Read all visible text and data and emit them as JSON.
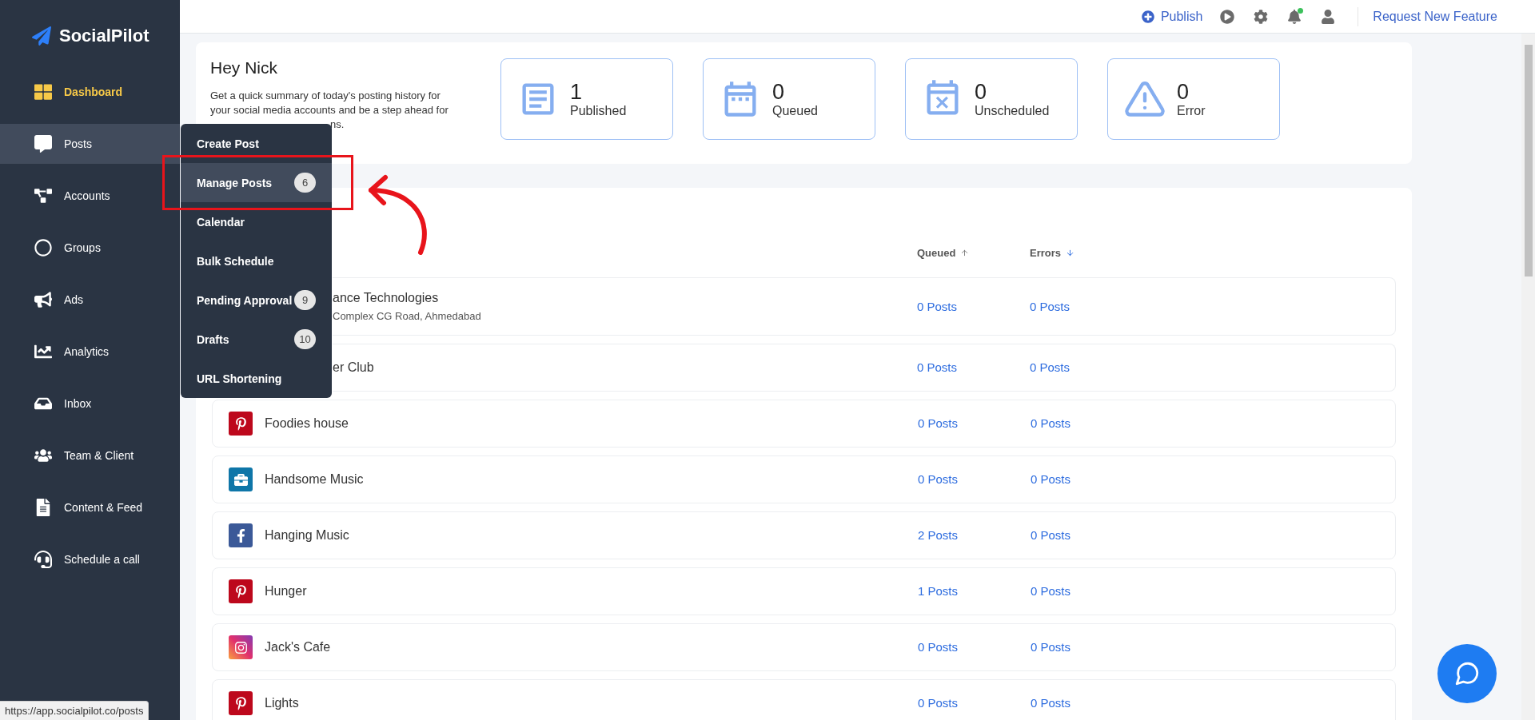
{
  "brand": "SocialPilot",
  "sidebar": {
    "items": [
      {
        "label": "Dashboard",
        "selected": true,
        "hovered": false
      },
      {
        "label": "Posts",
        "selected": false,
        "hovered": true
      },
      {
        "label": "Accounts",
        "selected": false,
        "hovered": false
      },
      {
        "label": "Groups",
        "selected": false,
        "hovered": false
      },
      {
        "label": "Ads",
        "selected": false,
        "hovered": false
      },
      {
        "label": "Analytics",
        "selected": false,
        "hovered": false
      },
      {
        "label": "Inbox",
        "selected": false,
        "hovered": false
      },
      {
        "label": "Team & Client",
        "selected": false,
        "hovered": false
      },
      {
        "label": "Content & Feed",
        "selected": false,
        "hovered": false
      },
      {
        "label": "Schedule a call",
        "selected": false,
        "hovered": false
      }
    ]
  },
  "topbar": {
    "publish": "Publish",
    "request": "Request New Feature",
    "notification_dot": true
  },
  "summary": {
    "greeting": "Hey Nick",
    "lines": [
      {
        "text": "Get a quick summary of today's posting history for",
        "covered": false
      },
      {
        "text": "your social media accounts and be a step ahead for",
        "covered": false
      },
      {
        "text": "ns.",
        "covered": true
      }
    ],
    "stats": [
      {
        "value": "1",
        "label": "Published"
      },
      {
        "value": "0",
        "label": "Queued"
      },
      {
        "value": "0",
        "label": "Unscheduled"
      },
      {
        "value": "0",
        "label": "Error"
      }
    ]
  },
  "table": {
    "columns": [
      {
        "label": "Queued",
        "ascending": true,
        "active": false
      },
      {
        "label": "Errors",
        "ascending": false,
        "active": true
      }
    ],
    "rows": [
      {
        "kind": "covered",
        "name": "ance Technologies",
        "subtitle": "Complex CG Road, Ahmedabad",
        "queued": "0 Posts",
        "errors": "0 Posts"
      },
      {
        "kind": "covered",
        "name": "er Club",
        "queued": "0 Posts",
        "errors": "0 Posts"
      },
      {
        "kind": "pinterest",
        "name": "Foodies house",
        "queued": "0 Posts",
        "errors": "0 Posts"
      },
      {
        "kind": "business",
        "name": "Handsome Music",
        "queued": "0 Posts",
        "errors": "0 Posts"
      },
      {
        "kind": "facebook",
        "name": "Hanging Music",
        "queued": "2 Posts",
        "errors": "0 Posts"
      },
      {
        "kind": "pinterest",
        "name": "Hunger",
        "queued": "1 Posts",
        "errors": "0 Posts"
      },
      {
        "kind": "instagram",
        "name": "Jack's Cafe",
        "queued": "0 Posts",
        "errors": "0 Posts"
      },
      {
        "kind": "pinterest",
        "name": "Lights",
        "queued": "0 Posts",
        "errors": "0 Posts"
      }
    ]
  },
  "posts_menu": {
    "items": [
      {
        "label": "Create Post",
        "hovered": false
      },
      {
        "label": "Manage Posts",
        "badge": "6",
        "hovered": true
      },
      {
        "label": "Calendar",
        "hovered": false
      },
      {
        "label": "Bulk Schedule",
        "hovered": false
      },
      {
        "label": "Pending Approval",
        "badge": "9",
        "hovered": false
      },
      {
        "label": "Drafts",
        "badge": "10",
        "hovered": false
      },
      {
        "label": "URL Shortening",
        "hovered": false
      }
    ]
  },
  "status_url": "https://app.socialpilot.co/posts"
}
